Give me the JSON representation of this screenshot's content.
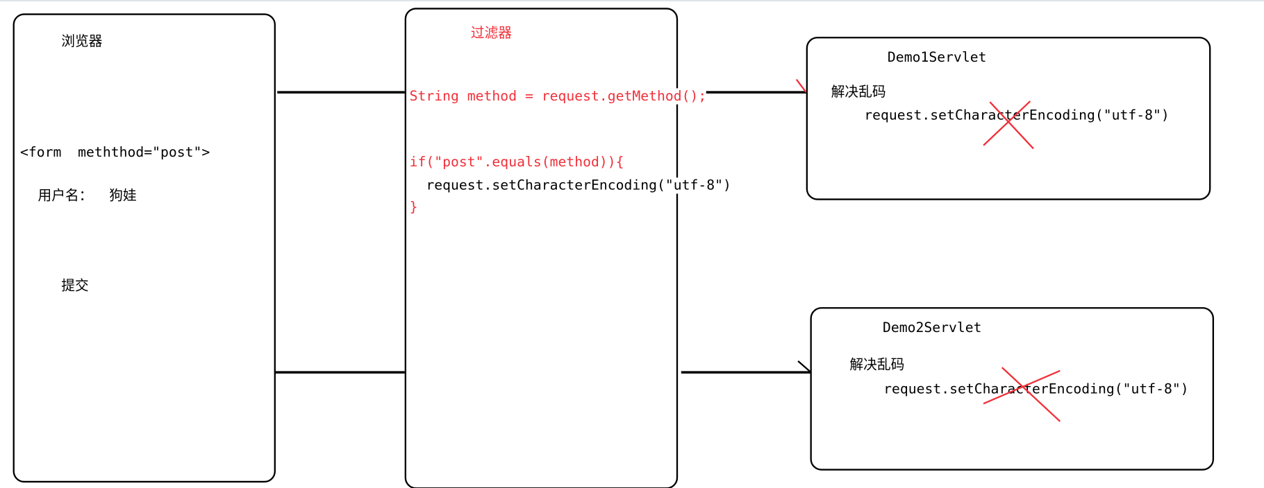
{
  "browser": {
    "title": "浏览器",
    "form_tag": "<form  meththod=\"post\">",
    "username_row": "用户名：  狗娃",
    "submit": "提交"
  },
  "filter": {
    "title": "过滤器",
    "line1": "String method = request.getMethod();",
    "line2": "if(\"post\".equals(method)){",
    "line3": "  request.setCharacterEncoding(\"utf-8\")",
    "line4": "}"
  },
  "servlet1": {
    "title": "Demo1Servlet",
    "note": "解决乱码",
    "code": "request.setCharacterEncoding(\"utf-8\")"
  },
  "servlet2": {
    "title": "Demo2Servlet",
    "note": "解决乱码",
    "code": "request.setCharacterEncoding(\"utf-8\")"
  },
  "colors": {
    "annotation": "#f0303a",
    "lines": "#000000"
  }
}
